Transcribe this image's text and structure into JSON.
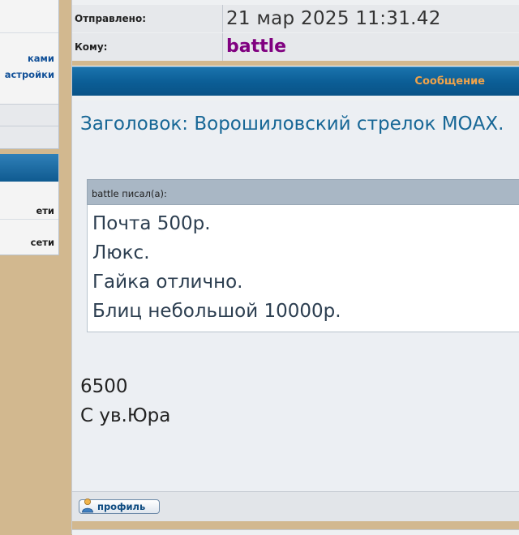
{
  "sidebar": {
    "links": [
      "ками",
      "астройки"
    ],
    "items": [
      "ети",
      "сети"
    ]
  },
  "message": {
    "sent_label": "Отправлено:",
    "sent_value": "21 мар 2025 11:31.42",
    "to_label": "Кому:",
    "to_value": "battle",
    "header_label": "Сообщение",
    "subject": "Заголовок: Ворошиловский стрелок МОАХ.",
    "quote_author": "battle писал(а):",
    "quote_lines": [
      "Почта 500р.",
      "Люкс.",
      "Гайка отлично.",
      "Блиц небольшой 10000р."
    ],
    "reply_lines": [
      "6500",
      "С ув.Юра"
    ],
    "profile_button": "профиль"
  },
  "colors": {
    "page_background": "#d2b88f",
    "header_blue": "#0b5d95",
    "header_label": "#f0a34a",
    "recipient": "#800080",
    "subject": "#176796",
    "link": "#115098"
  },
  "icons": {
    "profile": "user-icon"
  }
}
